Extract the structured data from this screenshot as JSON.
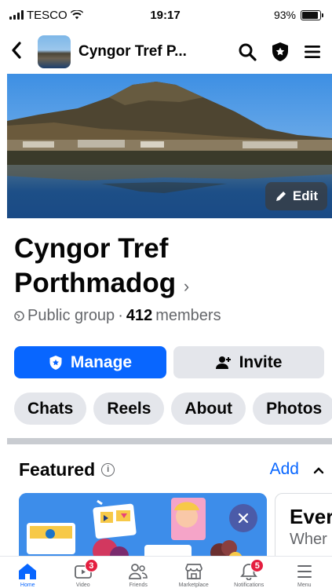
{
  "status_bar": {
    "carrier": "TESCO",
    "time": "19:17",
    "battery_percent": "93%",
    "battery_level": 0.93
  },
  "header": {
    "title": "Cyngor Tref P..."
  },
  "cover": {
    "edit_label": "Edit"
  },
  "group": {
    "name": "Cyngor Tref Porthmadog",
    "name_chevron": "›",
    "privacy": "Public group",
    "separator": "·",
    "member_count": "412",
    "members_label": "members"
  },
  "actions": {
    "manage_label": "Manage",
    "invite_label": "Invite"
  },
  "tabs": [
    {
      "label": "Chats"
    },
    {
      "label": "Reels"
    },
    {
      "label": "About"
    },
    {
      "label": "Photos"
    }
  ],
  "featured": {
    "title": "Featured",
    "add_label": "Add",
    "card2_title": "Ever",
    "card2_subtitle": "Wher"
  },
  "bottom_nav": [
    {
      "label": "Home",
      "icon": "home-icon",
      "active": true,
      "badge": ""
    },
    {
      "label": "Video",
      "icon": "video-icon",
      "active": false,
      "badge": "3"
    },
    {
      "label": "Friends",
      "icon": "friends-icon",
      "active": false,
      "badge": ""
    },
    {
      "label": "Marketplace",
      "icon": "marketplace-icon",
      "active": false,
      "badge": ""
    },
    {
      "label": "Notifications",
      "icon": "bell-icon",
      "active": false,
      "badge": "5"
    },
    {
      "label": "Menu",
      "icon": "menu-icon",
      "active": false,
      "badge": ""
    }
  ],
  "colors": {
    "accent": "#0866ff",
    "badge": "#e41e3f",
    "secondary_button": "#e4e6eb"
  }
}
